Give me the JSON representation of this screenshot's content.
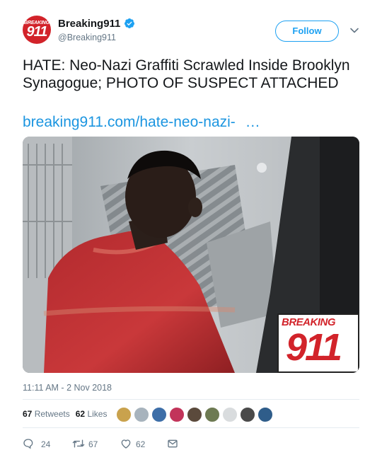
{
  "author": {
    "name": "Breaking911",
    "handle": "@Breaking911",
    "avatar_text_top": "BREAKING",
    "avatar_text_num": "911",
    "verified_icon": "verified-badge-icon"
  },
  "follow_label": "Follow",
  "tweet": {
    "text": "HATE: Neo-Nazi Graffiti Scrawled Inside Brooklyn Synagogue; PHOTO OF SUSPECT ATTACHED",
    "link_text": "breaking911.com/hate-neo-nazi-",
    "link_ellipsis": "…"
  },
  "media": {
    "watermark_top": "BREAKING",
    "watermark_num": "911"
  },
  "timestamp": "11:11 AM - 2 Nov 2018",
  "stats": {
    "retweets_count": "67",
    "retweets_label": "Retweets",
    "likes_count": "62",
    "likes_label": "Likes"
  },
  "actions": {
    "reply_count": "24",
    "retweet_count": "67",
    "like_count": "62"
  },
  "colors": {
    "accent": "#1da1f2",
    "brand_red": "#d2232a",
    "muted": "#657786"
  }
}
